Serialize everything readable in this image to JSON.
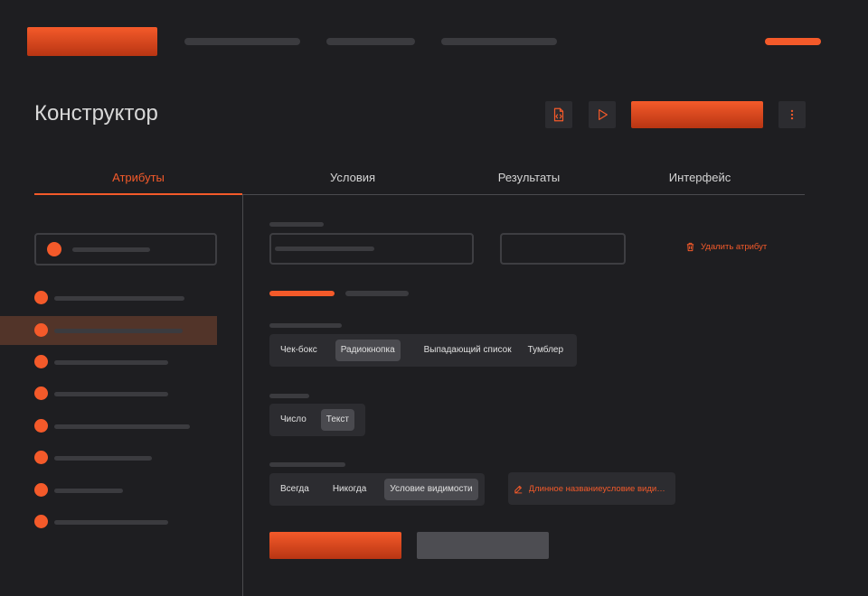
{
  "header": {
    "title": "Конструктор"
  },
  "tabs": [
    {
      "label": "Атрибуты",
      "active": true
    },
    {
      "label": "Условия",
      "active": false
    },
    {
      "label": "Результаты",
      "active": false
    },
    {
      "label": "Интерфейс",
      "active": false
    }
  ],
  "main": {
    "delete_label": "Удалить атрибут",
    "type_options": [
      "Чек-бокс",
      "Радиокнопка",
      "Выпадающий список",
      "Тумблер"
    ],
    "type_selected": "Радиокнопка",
    "format_options": [
      "Число",
      "Текст"
    ],
    "format_selected": "Текст",
    "visibility_options": [
      "Всегда",
      "Никогда",
      "Условие видимости"
    ],
    "visibility_selected": "Условие видимости",
    "condition_link": "Длинное названиеусловие видимо..."
  },
  "sidebar": {
    "selected_index": 1
  },
  "colors": {
    "accent": "#f45a2a",
    "background": "#1e1e21",
    "surface": "#2c2c30",
    "selected_row": "#523429"
  },
  "icons": [
    "file-code-icon",
    "play-icon",
    "more-vertical-icon",
    "trash-icon",
    "pencil-icon"
  ]
}
